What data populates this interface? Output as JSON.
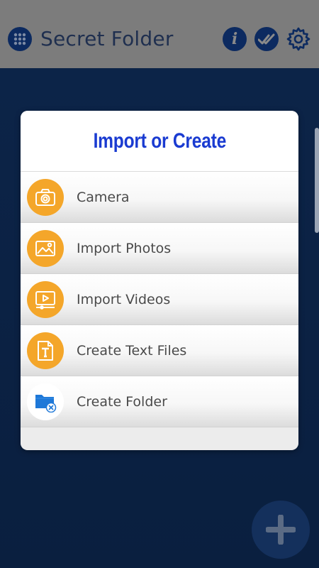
{
  "appbar": {
    "title": "Secret Folder",
    "info_glyph": "i",
    "icons": [
      "grid-menu-icon",
      "info-icon",
      "double-check-icon",
      "gear-icon"
    ]
  },
  "dialog": {
    "title": "Import or Create",
    "options": [
      {
        "label": "Camera",
        "icon": "camera-icon"
      },
      {
        "label": "Import Photos",
        "icon": "photo-icon"
      },
      {
        "label": "Import Videos",
        "icon": "video-icon"
      },
      {
        "label": "Create Text Files",
        "icon": "text-file-icon"
      },
      {
        "label": "Create Folder",
        "icon": "folder-icon"
      }
    ]
  },
  "fab": {
    "icon": "plus-icon"
  },
  "colors": {
    "accent_orange": "#f4a62a",
    "title_blue": "#1a3bd1",
    "navy": "#0c2a60",
    "background": "#0f2447"
  }
}
